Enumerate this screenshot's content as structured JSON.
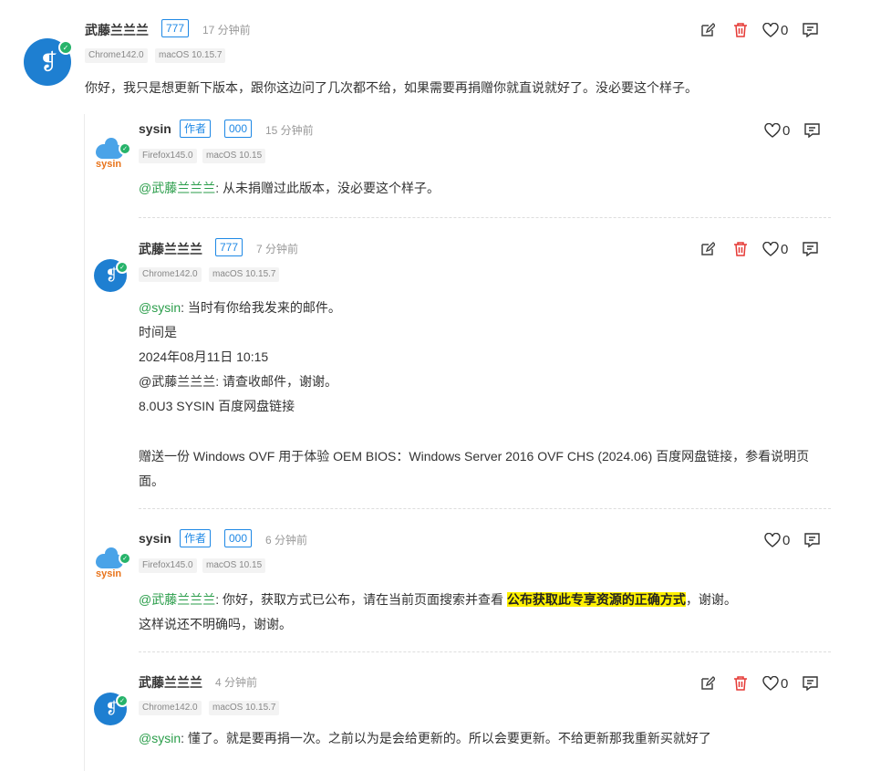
{
  "comments": [
    {
      "user": "武藤兰兰兰",
      "badge": "777",
      "time": "17 分钟前",
      "browser": "Chrome142.0",
      "os": "macOS 10.15.7",
      "likes": "0",
      "text": "你好，我只是想更新下版本，跟你这边问了几次都不给，如果需要再捐赠你就直说就好了。没必要这个样子。"
    }
  ],
  "replies": [
    {
      "user": "sysin",
      "author_badge": "作者",
      "badge": "000",
      "time": "15 分钟前",
      "browser": "Firefox145.0",
      "os": "macOS 10.15",
      "likes": "0",
      "mention": "@武藤兰兰兰",
      "text": ": 从未捐赠过此版本，没必要这个样子。"
    },
    {
      "user": "武藤兰兰兰",
      "badge": "777",
      "time": "7 分钟前",
      "browser": "Chrome142.0",
      "os": "macOS 10.15.7",
      "likes": "0",
      "mention": "@sysin",
      "lines": [
        ": 当时有你给我发来的邮件。",
        "时间是",
        "2024年08月11日 10:15",
        "@武藤兰兰兰: 请查收邮件，谢谢。",
        "8.0U3 SYSIN 百度网盘链接"
      ],
      "extra": "赠送一份 Windows OVF 用于体验 OEM BIOS：Windows Server 2016 OVF CHS (2024.06) 百度网盘链接，参看说明页面。"
    },
    {
      "user": "sysin",
      "author_badge": "作者",
      "badge": "000",
      "time": "6 分钟前",
      "browser": "Firefox145.0",
      "os": "macOS 10.15",
      "likes": "0",
      "mention": "@武藤兰兰兰",
      "text_before": ": 你好，获取方式已公布，请在当前页面搜索并查看 ",
      "highlight": "公布获取此专享资源的正确方式",
      "text_after": "，谢谢。",
      "line2": "这样说还不明确吗，谢谢。"
    },
    {
      "user": "武藤兰兰兰",
      "time": "4 分钟前",
      "browser": "Chrome142.0",
      "os": "macOS 10.15.7",
      "likes": "0",
      "mention": "@sysin",
      "text": ": 懂了。就是要再捐一次。之前以为是会给更新的。所以会要更新。不给更新那我重新买就好了"
    }
  ],
  "icons": {
    "edit": "edit-icon",
    "delete": "trash-icon",
    "like": "heart-icon",
    "reply": "reply-icon"
  },
  "colors": {
    "mention": "#2a9d4a",
    "badge": "#1e88e5",
    "delete": "#e53935",
    "highlight": "#fff100"
  }
}
